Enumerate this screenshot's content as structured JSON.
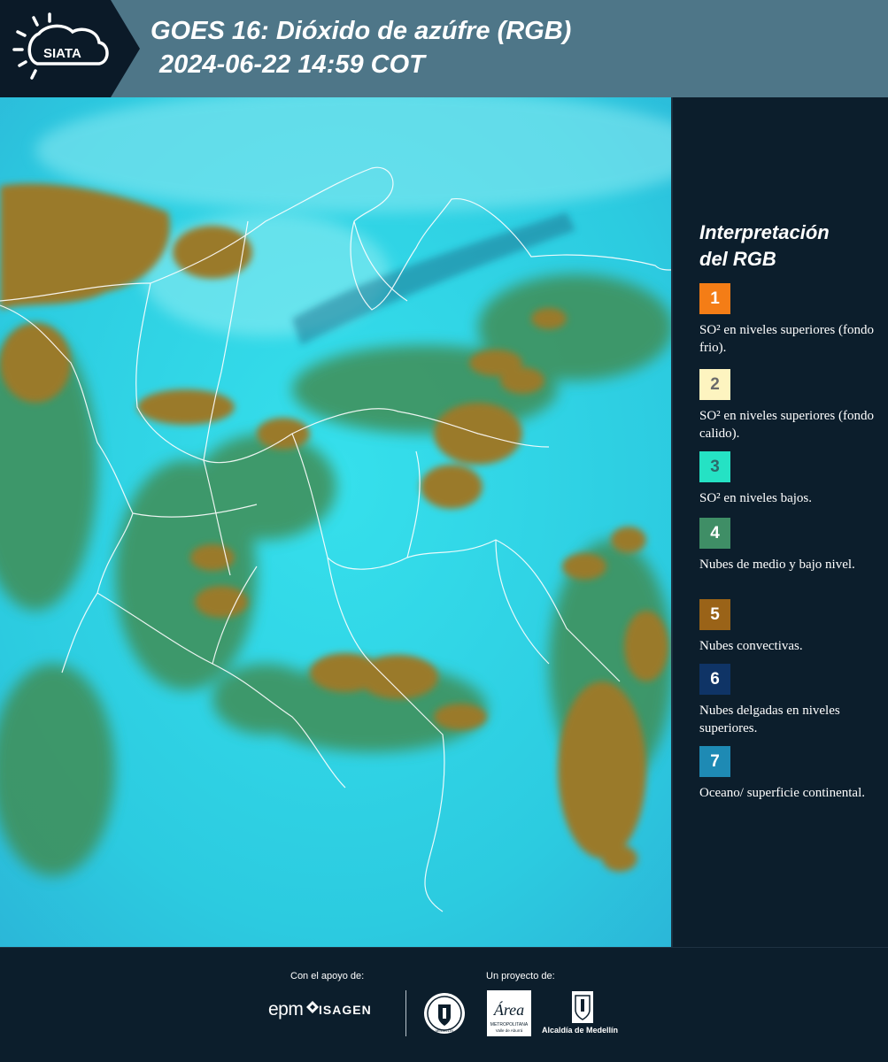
{
  "header": {
    "logo_text": "SIATA",
    "title_line1": "GOES 16: Dióxido de azúfre (RGB)",
    "title_line2": "2024-06-22 14:59 COT"
  },
  "legend": {
    "title_line1": "Interpretación",
    "title_line2": "del RGB",
    "items": [
      {
        "number": "1",
        "label": "SO² en niveles superiores (fondo frio).",
        "color": "#f47d16",
        "text_color": "#ffffff"
      },
      {
        "number": "2",
        "label": "SO² en niveles superiores (fondo calido).",
        "color": "#fdf4c0",
        "text_color": "#6b6b6b"
      },
      {
        "number": "3",
        "label": "SO² en niveles bajos.",
        "color": "#25e2c4",
        "text_color": "#2c6a6a"
      },
      {
        "number": "4",
        "label": "Nubes de medio y bajo nivel.",
        "color": "#3f8e66",
        "text_color": "#ffffff"
      },
      {
        "number": "5",
        "label": "Nubes convectivas.",
        "color": "#9a6318",
        "text_color": "#ffffff"
      },
      {
        "number": "6",
        "label": "Nubes delgadas en niveles superiores.",
        "color": "#0f3466",
        "text_color": "#ffffff"
      },
      {
        "number": "7",
        "label": "Oceano/ superficie continental.",
        "color": "#1e8ab4",
        "text_color": "#ffffff"
      }
    ]
  },
  "footer": {
    "support_label": "Con el apoyo de:",
    "project_label": "Un proyecto de:",
    "epm": "epm",
    "isagen": "ISAGEN",
    "area_text": "Área",
    "area_sub1": "METROPOLITANA",
    "area_sub2": "Valle de Aburrá",
    "alcaldia": "Alcaldía de Medellín",
    "seal_text": "MEDELLÍN"
  },
  "colors": {
    "header_band": "#4e7688",
    "header_dark": "#0b1a28",
    "panel": "#0c1e2c",
    "sky": "#2ad4e4",
    "convective": "#9a7a2a",
    "vegetation": "#3f8e56"
  }
}
